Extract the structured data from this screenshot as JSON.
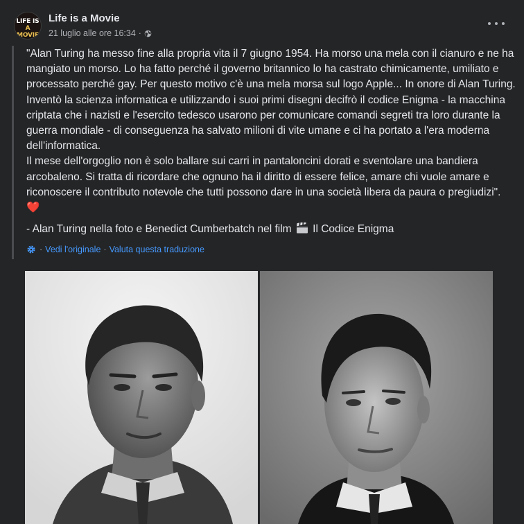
{
  "post": {
    "page_name": "Life is a Movie",
    "avatar": {
      "line1": "LIFE IS",
      "line2": "A MOVIE"
    },
    "timestamp": "21 luglio alle ore 16:34",
    "separator": "·",
    "privacy_icon": "globe-icon",
    "menu_icon": "more-horizontal-icon",
    "body": "\"Alan Turing ha messo fine alla propria vita il 7 giugno 1954. Ha morso una mela con il cianuro e ne ha mangiato un morso. Lo ha fatto perché il governo britannico lo ha castrato chimicamente, umiliato e processato perché gay. Per questo motivo c'è una mela morsa sul logo Apple... In onore di Alan Turing. Inventò la scienza informatica e utilizzando i suoi primi disegni decifrò il codice Enigma - la macchina criptata che i nazisti e l'esercito tedesco usarono per comunicare comandi segreti tra loro durante la guerra mondiale - di conseguenza ha salvato milioni di vite umane e ci ha portato a l'era moderna dell'informatica.\nIl mese dell'orgoglio non è solo ballare sui carri in pantaloncini dorati e sventolare una bandiera arcobaleno. Si tratta di ricordare che ognuno ha il diritto di essere felice, amare chi vuole amare e riconoscere il contributo notevole che tutti possono dare in una società libera da paura o pregiudizi\". ",
    "heart": "❤️",
    "credit_before": "- Alan Turing nella foto e Benedict Cumberbatch nel film ",
    "credit_icon": "clapper-board-icon",
    "credit_after": " Il Codice Enigma",
    "translation": {
      "icon": "translate-gear-icon",
      "see_original": "Vedi l'originale",
      "rate": "Valuta questa traduzione",
      "separator": "·"
    },
    "photos": [
      {
        "name": "alan-turing-photo"
      },
      {
        "name": "benedict-cumberbatch-photo"
      }
    ],
    "colors": {
      "background": "#242526",
      "text": "#e4e6eb",
      "secondary": "#b0b3b8",
      "link": "#4599ff",
      "heart": "#f02849"
    }
  }
}
